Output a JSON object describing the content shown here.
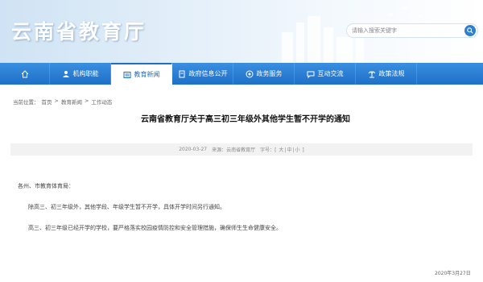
{
  "header": {
    "site_title": "云南省教育厅",
    "search_placeholder": "请输入搜索关键字",
    "brand_color": "#1f6fc7"
  },
  "nav": {
    "items": [
      {
        "label": "",
        "icon": "home-icon"
      },
      {
        "label": "机构职能",
        "icon": "people-icon"
      },
      {
        "label": "教育新闻",
        "icon": "news-icon",
        "active": true
      },
      {
        "label": "政府信息公开",
        "icon": "document-icon"
      },
      {
        "label": "政务服务",
        "icon": "service-icon"
      },
      {
        "label": "互动交流",
        "icon": "chat-icon"
      },
      {
        "label": "政策法规",
        "icon": "law-icon"
      }
    ]
  },
  "breadcrumb": {
    "prefix": "当前位置：",
    "items": [
      "首页",
      "教育新闻",
      "工作动态"
    ],
    "separator": ">"
  },
  "article": {
    "title": "云南省教育厅关于高三初三年级外其他学生暂不开学的通知",
    "meta_date": "2020-03-27",
    "meta_source": "来源：云南省教育厅",
    "size_prefix": "字号：[",
    "size_large": "大",
    "size_mid": "中",
    "size_small": "小",
    "size_suffix": "]",
    "salutation": "各州、市教育体育局：",
    "para1": "除高三、初三年级外，其他学段、年级学生暂不开学，具体开学时间另行通知。",
    "para2": "高三、初三年级已经开学的学校，要严格落实校园疫情防控和安全管理措施，确保师生生命健康安全。",
    "footer_date": "2020年3月27日"
  }
}
